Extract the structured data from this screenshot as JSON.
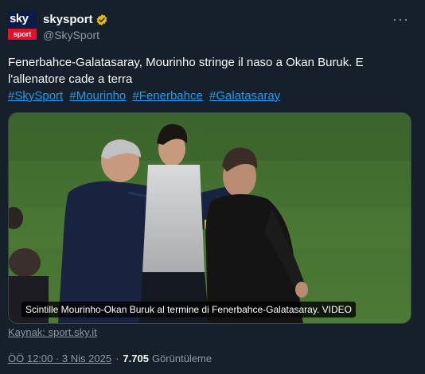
{
  "account": {
    "display_name": "skysport",
    "handle": "@SkySport",
    "avatar_top": "sky",
    "avatar_bottom": "sport"
  },
  "more_label": "···",
  "tweet_text": "Fenerbahce-Galatasaray, Mourinho stringe il naso a Okan Buruk. E l'allenatore cade a terra",
  "hashtags": [
    "#SkySport",
    "#Mourinho",
    "#Fenerbahce",
    "#Galatasaray"
  ],
  "media": {
    "caption": "Scintille Mourinho-Okan Buruk al termine di Fenerbahce-Galatasaray. VIDEO"
  },
  "source_link": "Kaynak: sport.sky.it",
  "meta": {
    "time": "ÖÖ 12:00 · 3 Nis 2025",
    "separator": "·",
    "views_count": "7.705",
    "views_label": "Görüntüleme"
  },
  "colors": {
    "background": "#15202b",
    "link": "#1d9bf0",
    "muted": "#8b98a5",
    "verified": "#e2b719",
    "sky_red": "#e0122a"
  }
}
